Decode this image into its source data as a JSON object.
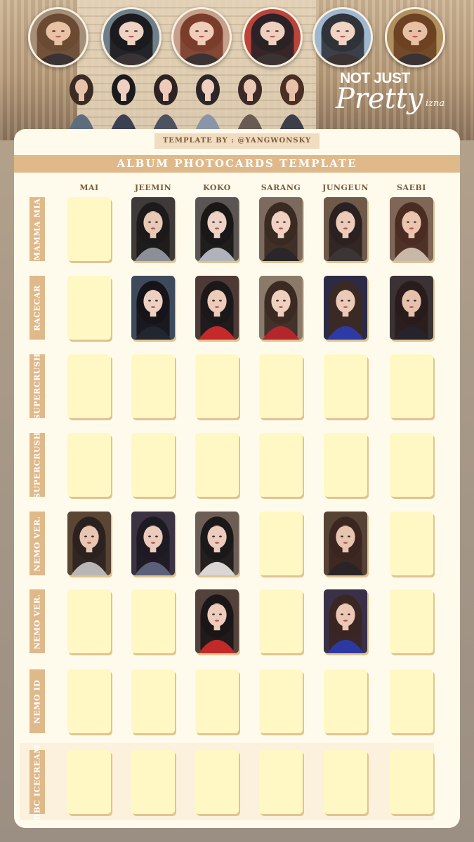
{
  "banner": {
    "logo_line1": "NOT JUST",
    "logo_line2": "Pretty",
    "logo_line3": "izna",
    "avatars": [
      {
        "icon": "member-portrait-icon",
        "skin": "#e9c1a4",
        "hair": "#6b4a33",
        "bg": "#a58f78"
      },
      {
        "icon": "member-portrait-icon",
        "skin": "#efd2c1",
        "hair": "#1b1b1f",
        "bg": "#6e7f88"
      },
      {
        "icon": "member-portrait-icon",
        "skin": "#f0cdb8",
        "hair": "#7b3d2b",
        "bg": "#c6a08a"
      },
      {
        "icon": "member-portrait-icon",
        "skin": "#efd0bf",
        "hair": "#2a2226",
        "bg": "#b9443a"
      },
      {
        "icon": "member-portrait-icon",
        "skin": "#f1d4c4",
        "hair": "#30333a",
        "bg": "#9fb8cf"
      },
      {
        "icon": "member-portrait-icon",
        "skin": "#e9c0a3",
        "hair": "#6d4224",
        "bg": "#b0905e"
      }
    ],
    "group_photo_icon": "group-photo-icon"
  },
  "credit": "TEMPLATE BY : @YANGWONSKY",
  "title": "ALBUM PHOTOCARDS TEMPLATE",
  "members": [
    "MAI",
    "JEEMIN",
    "KOKO",
    "SARANG",
    "JUNGEUN",
    "SAEBI"
  ],
  "rows": [
    {
      "label": "MAMMA MIA",
      "cards": [
        {
          "filled": false
        },
        {
          "filled": true,
          "bg": "#3f3a38",
          "skin": "#e8c9b6",
          "hair": "#1c1a1a",
          "outfit": "#8c8f96"
        },
        {
          "filled": true,
          "bg": "#5a5552",
          "skin": "#edd3c6",
          "hair": "#1a1717",
          "outfit": "#b0b3b9"
        },
        {
          "filled": true,
          "bg": "#7c6a5e",
          "skin": "#f0d2c3",
          "hair": "#3a2a22",
          "outfit": "#2a2629"
        },
        {
          "filled": true,
          "bg": "#6f5a4a",
          "skin": "#ecccb9",
          "hair": "#2b2120",
          "outfit": "#3b3536"
        },
        {
          "filled": true,
          "bg": "#7f6656",
          "skin": "#ebc5ae",
          "hair": "#4a2c22",
          "outfit": "#c9b8a8"
        }
      ]
    },
    {
      "label": "RACECAR",
      "cards": [
        {
          "filled": false
        },
        {
          "filled": true,
          "bg": "#3d4a5c",
          "skin": "#ecd0c2",
          "hair": "#161418",
          "outfit": "#22262f"
        },
        {
          "filled": true,
          "bg": "#4d3a36",
          "skin": "#eccbb9",
          "hair": "#1c1819",
          "outfit": "#c42a2a"
        },
        {
          "filled": true,
          "bg": "#8b7a6a",
          "skin": "#efd0bf",
          "hair": "#3b2a22",
          "outfit": "#b3262b"
        },
        {
          "filled": true,
          "bg": "#2c2a44",
          "skin": "#eccab8",
          "hair": "#3b2a24",
          "outfit": "#2d3aa6"
        },
        {
          "filled": true,
          "bg": "#3a3234",
          "skin": "#e6c1ad",
          "hair": "#2a1c1c",
          "outfit": "#26232a"
        }
      ]
    },
    {
      "label": "SUPERCRUSH",
      "cards": [
        {
          "filled": false
        },
        {
          "filled": false
        },
        {
          "filled": false
        },
        {
          "filled": false
        },
        {
          "filled": false
        },
        {
          "filled": false
        }
      ]
    },
    {
      "label": "SUPERCRUSH",
      "cards": [
        {
          "filled": false
        },
        {
          "filled": false
        },
        {
          "filled": false
        },
        {
          "filled": false
        },
        {
          "filled": false
        },
        {
          "filled": false
        }
      ]
    },
    {
      "label": "NEMO VER.",
      "cards": [
        {
          "filled": true,
          "bg": "#5b4636",
          "skin": "#e9c6b2",
          "hair": "#2b2220",
          "outfit": "#b9b7b5"
        },
        {
          "filled": true,
          "bg": "#3b3242",
          "skin": "#ebcbbb",
          "hair": "#1e1a22",
          "outfit": "#5a5f7a"
        },
        {
          "filled": true,
          "bg": "#6d5e55",
          "skin": "#ecccbc",
          "hair": "#1b1819",
          "outfit": "#d9d6d3"
        },
        {
          "filled": false
        },
        {
          "filled": true,
          "bg": "#574236",
          "skin": "#e7c4ae",
          "hair": "#3b2620",
          "outfit": "#2a2427"
        },
        {
          "filled": false
        }
      ]
    },
    {
      "label": "NEMO VER.",
      "cards": [
        {
          "filled": false
        },
        {
          "filled": false
        },
        {
          "filled": true,
          "bg": "#53413b",
          "skin": "#edccbb",
          "hair": "#1b1618",
          "outfit": "#c22a2a"
        },
        {
          "filled": false
        },
        {
          "filled": true,
          "bg": "#3a3148",
          "skin": "#ecc8b4",
          "hair": "#3a2622",
          "outfit": "#2c39a3"
        },
        {
          "filled": false
        }
      ]
    },
    {
      "label": "NEMO ID",
      "cards": [
        {
          "filled": false
        },
        {
          "filled": false
        },
        {
          "filled": false
        },
        {
          "filled": false
        },
        {
          "filled": false
        },
        {
          "filled": false
        }
      ]
    },
    {
      "label": "BBC ICECREAM",
      "cards": [
        {
          "filled": false
        },
        {
          "filled": false
        },
        {
          "filled": false
        },
        {
          "filled": false
        },
        {
          "filled": false
        },
        {
          "filled": false
        }
      ]
    }
  ],
  "colors": {
    "panel": "#fffbec",
    "accent": "#dfb98a",
    "card_empty": "#fff8c4",
    "card_shadow": "#e1c391"
  }
}
